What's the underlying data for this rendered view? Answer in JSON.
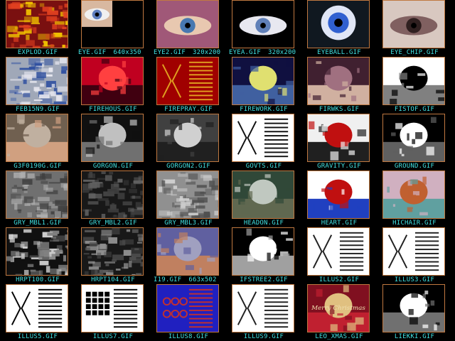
{
  "viewer": {
    "thumbnails": [
      {
        "file": "EXPLOD.GIF",
        "dims": "",
        "icon": "red-explosion-thumbnail",
        "colors": [
          "#7a1010",
          "#e04020",
          "#f0c000"
        ]
      },
      {
        "file": "EYE.GIF",
        "dims": "640x350",
        "icon": "eye-thumbnail",
        "colors": [
          "#000000",
          "#d8b8a0",
          "#6080c0"
        ]
      },
      {
        "file": "EYE2.GIF",
        "dims": "320x200",
        "icon": "eye-closeup-thumbnail",
        "colors": [
          "#a05878",
          "#e8c8b0",
          "#4878b0"
        ]
      },
      {
        "file": "EYEA.GIF",
        "dims": "320x200",
        "icon": "eye-on-black-thumbnail",
        "colors": [
          "#000000",
          "#e8e8f0",
          "#6080b8"
        ]
      },
      {
        "file": "EYEBALL.GIF",
        "dims": "",
        "icon": "eyeball-thumbnail",
        "colors": [
          "#101820",
          "#3060d0",
          "#d0d8f0"
        ]
      },
      {
        "file": "EYE_CHIP.GIF",
        "dims": "",
        "icon": "eye-chip-thumbnail",
        "colors": [
          "#d8c8c0",
          "#806060",
          "#302020"
        ]
      },
      {
        "file": "FEB15N9.GIF",
        "dims": "",
        "icon": "satellite-clouds-thumbnail",
        "colors": [
          "#a0a8b8",
          "#e8e8f0",
          "#3050a0"
        ]
      },
      {
        "file": "FIREHOUS.GIF",
        "dims": "",
        "icon": "firehouse-thumbnail",
        "colors": [
          "#c00020",
          "#ff4040",
          "#400010"
        ]
      },
      {
        "file": "FIREPRAY.GIF",
        "dims": "",
        "icon": "fire-prayer-text-thumbnail",
        "colors": [
          "#a00000",
          "#e0a020",
          "#ffffff"
        ]
      },
      {
        "file": "FIREWORK.GIF",
        "dims": "",
        "icon": "firework-night-thumbnail",
        "colors": [
          "#101040",
          "#e0e070",
          "#4060a0"
        ]
      },
      {
        "file": "FIRWKS.GIF",
        "dims": "",
        "icon": "fireworks-thumbnail",
        "colors": [
          "#402030",
          "#a07080",
          "#d0b0a0"
        ]
      },
      {
        "file": "FISTOF.GIF",
        "dims": "",
        "icon": "fist-drawing-thumbnail",
        "colors": [
          "#ffffff",
          "#000000",
          "#808080"
        ]
      },
      {
        "file": "G3F0190G.GIF",
        "dims": "",
        "icon": "room-scene-thumbnail",
        "colors": [
          "#706050",
          "#c0b0a0",
          "#d0a080"
        ]
      },
      {
        "file": "GORGON.GIF",
        "dims": "",
        "icon": "gorgon-figure-thumbnail",
        "colors": [
          "#101010",
          "#c0c0c0",
          "#707070"
        ]
      },
      {
        "file": "GORGON2.GIF",
        "dims": "",
        "icon": "gorgon2-figure-thumbnail",
        "colors": [
          "#404040",
          "#d0d0d0",
          "#202020"
        ]
      },
      {
        "file": "GOVTS.GIF",
        "dims": "",
        "icon": "government-document-thumbnail",
        "colors": [
          "#ffffff",
          "#101010",
          "#808080"
        ]
      },
      {
        "file": "GRAVITY.GIF",
        "dims": "",
        "icon": "gravity-apple-thumbnail",
        "colors": [
          "#f0f0f0",
          "#c01010",
          "#202020"
        ]
      },
      {
        "file": "GROUND.GIF",
        "dims": "",
        "icon": "ground-hand-thumbnail",
        "colors": [
          "#000000",
          "#ffffff",
          "#606060"
        ]
      },
      {
        "file": "GRY_MBL1.GIF",
        "dims": "",
        "icon": "gray-marble-texture-thumbnail",
        "colors": [
          "#707070",
          "#b0b0b0",
          "#404040"
        ]
      },
      {
        "file": "GRY_MBL2.GIF",
        "dims": "",
        "icon": "dark-marble-texture-thumbnail",
        "colors": [
          "#181818",
          "#404040",
          "#606060"
        ]
      },
      {
        "file": "GRY_MBL3.GIF",
        "dims": "",
        "icon": "noise-texture-thumbnail",
        "colors": [
          "#909090",
          "#d0d0d0",
          "#505050"
        ]
      },
      {
        "file": "HEADON.GIF",
        "dims": "",
        "icon": "car-crash-thumbnail",
        "colors": [
          "#304838",
          "#c0c8c0",
          "#606850"
        ]
      },
      {
        "file": "HEART.GIF",
        "dims": "",
        "icon": "heart-anatomy-thumbnail",
        "colors": [
          "#ffffff",
          "#c01010",
          "#2040c0"
        ]
      },
      {
        "file": "HICHAIR.GIF",
        "dims": "",
        "icon": "highchair-toys-thumbnail",
        "colors": [
          "#d0b0c0",
          "#c06030",
          "#60a0a0"
        ]
      },
      {
        "file": "HRPT100.GIF",
        "dims": "",
        "icon": "satellite-coast-thumbnail",
        "colors": [
          "#101010",
          "#d0d0d0",
          "#808080"
        ]
      },
      {
        "file": "HRPT104.GIF",
        "dims": "",
        "icon": "satellite-dark-thumbnail",
        "colors": [
          "#181818",
          "#909090",
          "#505050"
        ]
      },
      {
        "file": "I19.GIF",
        "dims": "663x502",
        "icon": "person-at-computer-thumbnail",
        "colors": [
          "#6060a0",
          "#a0a0c0",
          "#c08060"
        ]
      },
      {
        "file": "IFSTREE2.GIF",
        "dims": "",
        "icon": "fractal-tree-thumbnail",
        "colors": [
          "#000000",
          "#ffffff",
          "#a0a0a0"
        ]
      },
      {
        "file": "ILLUS2.GIF",
        "dims": "",
        "icon": "arrow-illusion-thumbnail",
        "colors": [
          "#ffffff",
          "#202020",
          "#2020a0"
        ]
      },
      {
        "file": "ILLUS3.GIF",
        "dims": "",
        "icon": "lines-illusion-thumbnail",
        "colors": [
          "#ffffff",
          "#202020",
          "#c02020"
        ]
      },
      {
        "file": "ILLUS5.GIF",
        "dims": "",
        "icon": "faces-vase-illusion-thumbnail",
        "colors": [
          "#ffffff",
          "#000000",
          "#2040a0"
        ]
      },
      {
        "file": "ILLUS7.GIF",
        "dims": "",
        "icon": "grid-illusion-thumbnail",
        "colors": [
          "#ffffff",
          "#000000",
          "#c02020"
        ]
      },
      {
        "file": "ILLUS8.GIF",
        "dims": "",
        "icon": "circles-illusion-thumbnail",
        "colors": [
          "#2020c0",
          "#c03030",
          "#ffffff"
        ]
      },
      {
        "file": "ILLUS9.GIF",
        "dims": "",
        "icon": "curves-illusion-thumbnail",
        "colors": [
          "#ffffff",
          "#202020",
          "#2040a0"
        ]
      },
      {
        "file": "LEO_XMAS.GIF",
        "dims": "",
        "icon": "merry-christmas-card-thumbnail",
        "colors": [
          "#801020",
          "#e0c080",
          "#c02030"
        ],
        "caption": "Merry Christmas"
      },
      {
        "file": "LIEKKI.GIF",
        "dims": "",
        "icon": "flame-thumbnail",
        "colors": [
          "#000000",
          "#ffffff",
          "#707070"
        ]
      }
    ]
  },
  "theme": {
    "label_color": "#40e0e0",
    "border_color": "#c07840",
    "background": "#000000"
  }
}
